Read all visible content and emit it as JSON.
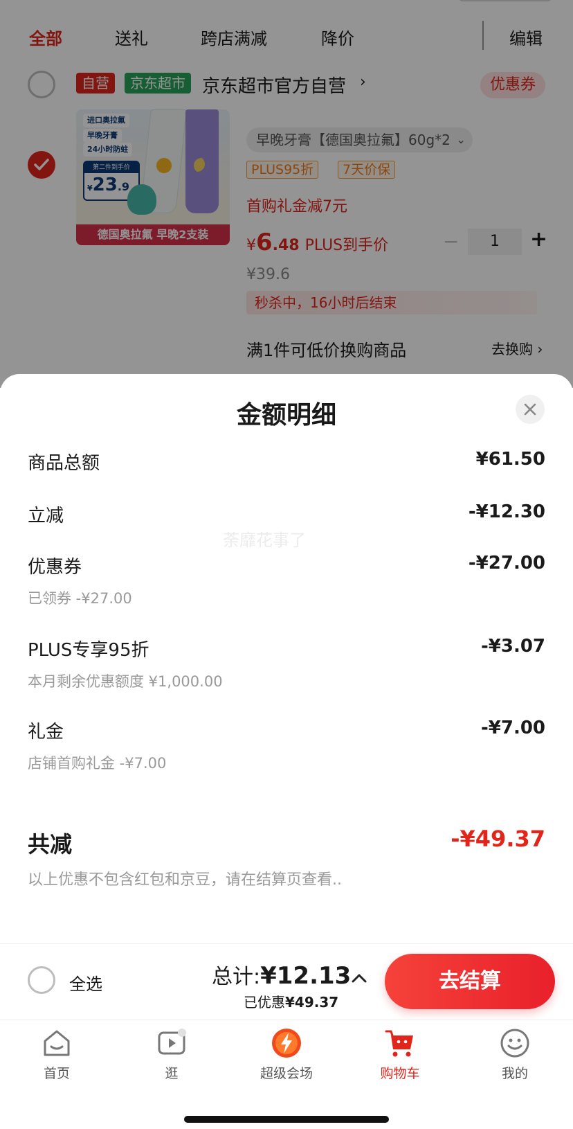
{
  "tabs": [
    {
      "label": "全部"
    },
    {
      "label": "送礼"
    },
    {
      "label": "跨店满减"
    },
    {
      "label": "降价"
    }
  ],
  "edit_label": "编辑",
  "store": {
    "badge_self": "自营",
    "badge_market": "京东超市",
    "name": "京东超市官方自营",
    "arrow": "›",
    "coupon_label": "优惠券"
  },
  "product": {
    "image_tags": [
      "进口奥拉氟",
      "早晚牙膏",
      "24小时防蛀"
    ],
    "image_price_head": "第二件到手价",
    "image_price_yen": "¥",
    "image_price": "23",
    "image_price_dec": ".9",
    "image_bottom": "德国奥拉氟 早晚2支装",
    "spec": "早晚牙膏【德国奥拉氟】60g*2",
    "tags": [
      "PLUS95折",
      "7天价保"
    ],
    "gift_text": "首购礼金减7元",
    "price_yen": "¥",
    "price_int": "6",
    "price_dec": ".48",
    "price_label": "PLUS到手价",
    "quantity": "1",
    "minus": "−",
    "plus": "+",
    "original_price": "¥39.6",
    "flash_sale": "秒杀中，16小时后结束",
    "swap_text": "满1件可低价换购商品",
    "swap_action": "去换购 ›"
  },
  "sheet": {
    "title": "金额明细",
    "watermark": "荼靡花事了",
    "lines": [
      {
        "label": "商品总额",
        "amount": "¥61.50"
      },
      {
        "label": "立减",
        "amount": "-¥12.30"
      },
      {
        "label": "优惠券",
        "amount": "-¥27.00",
        "sub": "已领券 -¥27.00"
      },
      {
        "label": "PLUS专享95折",
        "amount": "-¥3.07",
        "sub": "本月剩余优惠额度 ¥1,000.00"
      },
      {
        "label": "礼金",
        "amount": "-¥7.00",
        "sub": "店铺首购礼金 -¥7.00"
      }
    ],
    "total_label": "共减",
    "total_amount": "-¥49.37",
    "note": "以上优惠不包含红包和京豆，请在结算页查看.."
  },
  "checkout": {
    "select_all": "全选",
    "total_prefix": "总计:",
    "total_value": "¥12.13",
    "saved_prefix": "已优惠",
    "saved_value": "¥49.37",
    "pay_label": "去结算"
  },
  "nav": [
    {
      "label": "首页",
      "icon": "home-icon"
    },
    {
      "label": "逛",
      "icon": "video-play-icon"
    },
    {
      "label": "超级会场",
      "icon": "super-venue-icon"
    },
    {
      "label": "购物车",
      "icon": "cart-icon"
    },
    {
      "label": "我的",
      "icon": "profile-icon"
    }
  ],
  "colors": {
    "accent": "#e1251b",
    "market_green": "#29a25a",
    "plus_orange": "#f07a1a"
  }
}
